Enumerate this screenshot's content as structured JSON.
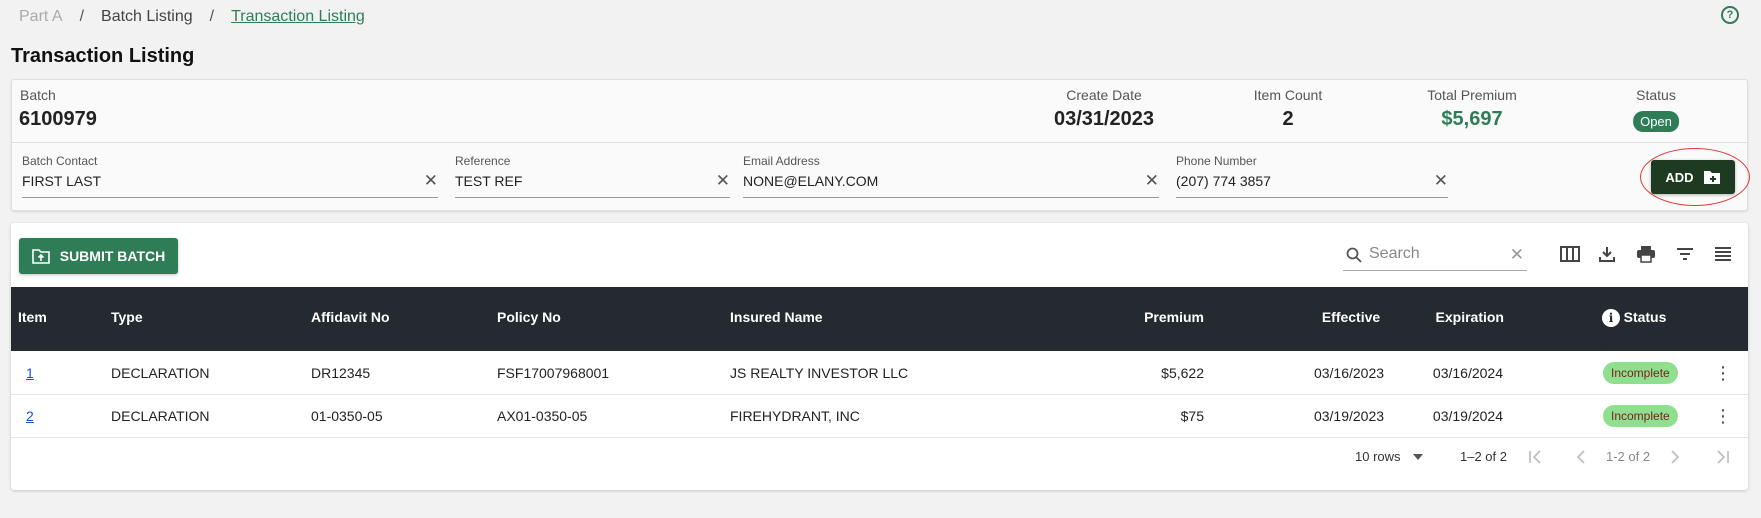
{
  "breadcrumb": {
    "items": [
      "Part A",
      "Batch Listing",
      "Transaction Listing"
    ],
    "separator": "/"
  },
  "help_icon": "help-circle-icon",
  "page_title": "Transaction Listing",
  "batch": {
    "batch_label": "Batch",
    "batch_value": "6100979",
    "create_date_label": "Create Date",
    "create_date_value": "03/31/2023",
    "item_count_label": "Item Count",
    "item_count_value": "2",
    "total_premium_label": "Total Premium",
    "total_premium_value": "$5,697",
    "status_label": "Status",
    "status_value": "Open"
  },
  "fields": {
    "contact": {
      "label": "Batch Contact",
      "value": "FIRST LAST"
    },
    "reference": {
      "label": "Reference",
      "value": "TEST REF"
    },
    "email": {
      "label": "Email Address",
      "value": "NONE@ELANY.COM"
    },
    "phone": {
      "label": "Phone Number",
      "value": "(207) 774 3857"
    },
    "clear_glyph": "✕"
  },
  "add_button": {
    "label": "ADD",
    "icon": "add-file-icon"
  },
  "toolbar": {
    "submit_label": "SUBMIT BATCH",
    "submit_icon": "folder-upload-icon",
    "search_placeholder": "Search",
    "icons": [
      "columns-icon",
      "download-icon",
      "print-icon",
      "filter-icon",
      "density-icon"
    ]
  },
  "table": {
    "columns": [
      "Item",
      "Type",
      "Affidavit No",
      "Policy No",
      "Insured Name",
      "Premium",
      "Effective",
      "Expiration",
      "Status"
    ],
    "rows": [
      {
        "item": "1",
        "type": "DECLARATION",
        "affidavit": "DR12345",
        "policy": "FSF17007968001",
        "insured": "JS REALTY INVESTOR LLC",
        "premium": "$5,622",
        "effective": "03/16/2023",
        "expiration": "03/16/2024",
        "status": "Incomplete"
      },
      {
        "item": "2",
        "type": "DECLARATION",
        "affidavit": "01-0350-05",
        "policy": "AX01-0350-05",
        "insured": "FIREHYDRANT, INC",
        "premium": "$75",
        "effective": "03/19/2023",
        "expiration": "03/19/2024",
        "status": "Incomplete"
      }
    ]
  },
  "pagination": {
    "rows_per_page": "10 rows",
    "range_text": "1–2 of 2",
    "page_text": "1-2 of 2"
  },
  "colors": {
    "brand_green": "#2e7d57",
    "header_dark": "#242a30",
    "add_button_bg": "#1e3b22",
    "incomplete_badge": "#8ee08f",
    "highlight_ring": "#e53935"
  }
}
